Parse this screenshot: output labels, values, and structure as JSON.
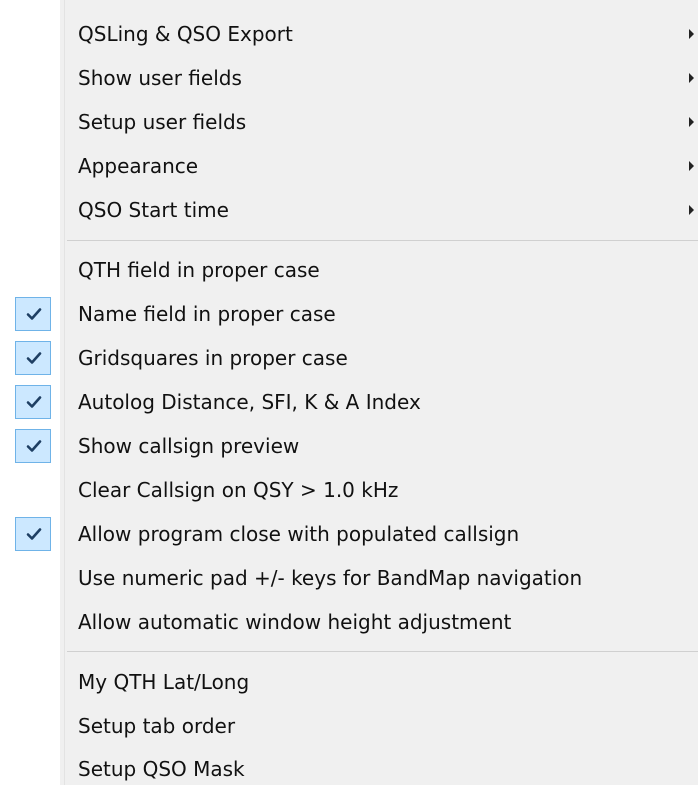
{
  "menu": {
    "submenu_items": [
      {
        "label": "QSLing & QSO Export"
      },
      {
        "label": "Show user fields"
      },
      {
        "label": "Setup user fields"
      },
      {
        "label": "Appearance"
      },
      {
        "label": "QSO Start time"
      }
    ],
    "option_items": [
      {
        "label": "QTH field in proper case",
        "checked": false
      },
      {
        "label": "Name field in proper case",
        "checked": true
      },
      {
        "label": "Gridsquares in proper case",
        "checked": true
      },
      {
        "label": "Autolog Distance, SFI, K & A Index",
        "checked": true
      },
      {
        "label": "Show callsign preview",
        "checked": true
      },
      {
        "label": "Clear Callsign on QSY > 1.0 kHz",
        "checked": false
      },
      {
        "label": "Allow program close with populated callsign",
        "checked": true
      },
      {
        "label": "Use numeric pad +/- keys for BandMap navigation",
        "checked": false
      },
      {
        "label": "Allow automatic window height adjustment",
        "checked": false
      }
    ],
    "setup_items": [
      {
        "label": "My QTH Lat/Long"
      },
      {
        "label": "Setup tab order"
      },
      {
        "label": "Setup QSO Mask"
      }
    ]
  },
  "colors": {
    "menu_background": "#f0f0f0",
    "check_highlight": "#cce8ff",
    "check_border": "#6fb3e8",
    "check_mark": "#1e3f63"
  },
  "icons": {
    "checked": "checkmark-icon",
    "submenu": "submenu-arrow-icon"
  }
}
